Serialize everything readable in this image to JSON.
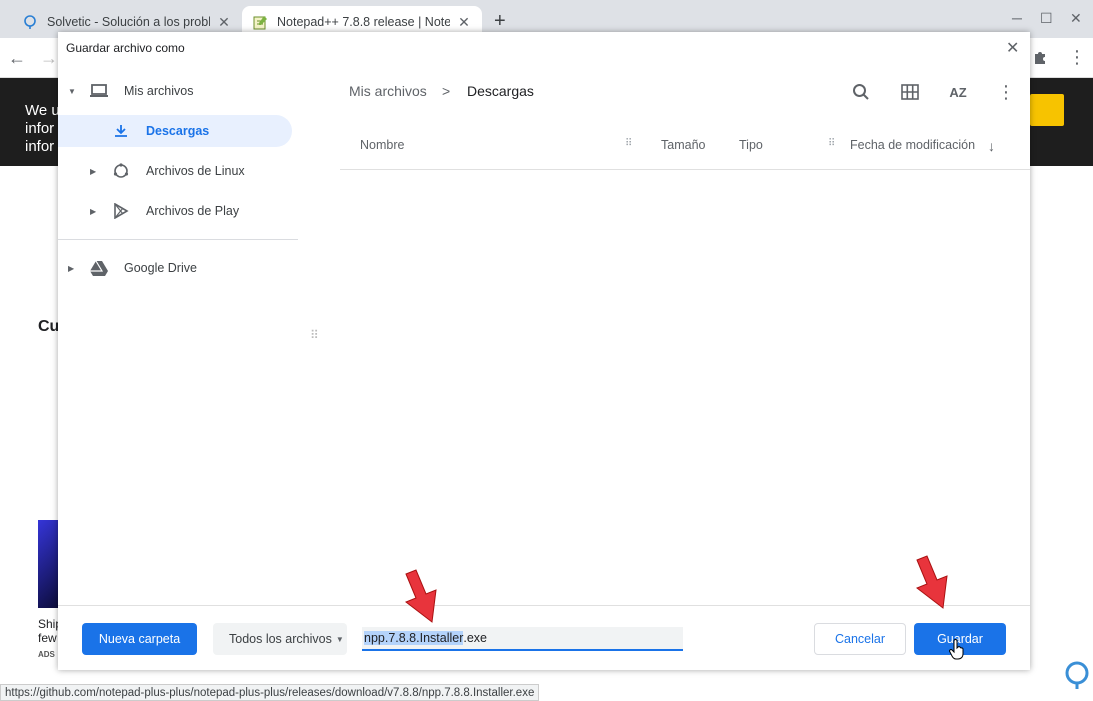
{
  "browser": {
    "tabs": [
      {
        "title": "Solvetic - Solución a los problem",
        "close": "✕"
      },
      {
        "title": "Notepad++ 7.8.8 release | Notep",
        "close": "✕"
      }
    ],
    "new_tab": "+",
    "window_controls": {
      "minimize": "─",
      "maximize": "☐",
      "close": "✕"
    }
  },
  "page": {
    "banner_text": "We u\ninfor\ninfor",
    "heading": "Cu",
    "caption": "Ship\nfew",
    "ads_label": "ADS"
  },
  "status_url": "https://github.com/notepad-plus-plus/notepad-plus-plus/releases/download/v7.8.8/npp.7.8.8.Installer.exe",
  "dialog": {
    "title": "Guardar archivo como",
    "close": "✕",
    "sidebar": {
      "items": [
        {
          "label": "Mis archivos",
          "icon": "laptop-icon"
        },
        {
          "label": "Descargas",
          "icon": "download-icon"
        },
        {
          "label": "Archivos de Linux",
          "icon": "linux-icon"
        },
        {
          "label": "Archivos de Play",
          "icon": "play-icon"
        },
        {
          "label": "Google Drive",
          "icon": "drive-icon"
        }
      ]
    },
    "breadcrumb": {
      "root": "Mis archivos",
      "separator": ">",
      "current": "Descargas"
    },
    "toolbar": {
      "sort_label": "AZ"
    },
    "columns": {
      "name": "Nombre",
      "size": "Tamaño",
      "type": "Tipo",
      "modified": "Fecha de modificación",
      "sort_indicator": "↓"
    },
    "footer": {
      "new_folder": "Nueva carpeta",
      "file_type": "Todos los archivos",
      "filename_selected": "npp.7.8.8.Installer",
      "filename_ext": ".exe",
      "cancel": "Cancelar",
      "save": "Guardar"
    }
  },
  "colors": {
    "accent": "#1a73e8",
    "annotation_arrow": "#e8343c",
    "banner_bg": "#1e1e1e",
    "cta_yellow": "#f7c300"
  }
}
